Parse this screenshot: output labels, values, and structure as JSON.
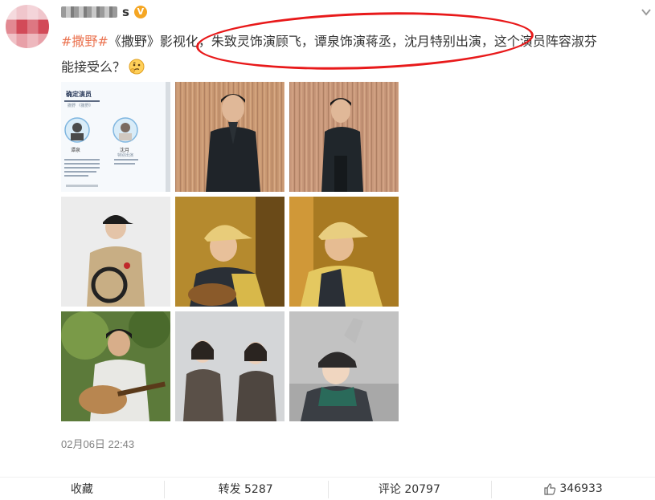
{
  "post": {
    "hashtag": "#撒野#",
    "text_main": "《撒野》影视化，朱致灵饰演顾飞，谭泉饰演蒋丞，沈月特别出演，这个演员阵容淑芬",
    "text_tail": "能接受么？",
    "timestamp": "02月06日 22:43"
  },
  "user": {
    "name_suffix": "s",
    "verified_icon": "v-verified-icon"
  },
  "photos": {
    "p1": {
      "header": "确定演员",
      "subheader": "撒野 《撒野》",
      "person1": "谭泉",
      "person2": "沈月",
      "person2_sub": "特别出演"
    }
  },
  "actions": {
    "favorite": "收藏",
    "repost": "转发 5287",
    "comment": "评论 20797",
    "like": "346933"
  },
  "colors": {
    "hashtag": "#eb7350",
    "highlight_ellipse": "#e8191a"
  }
}
